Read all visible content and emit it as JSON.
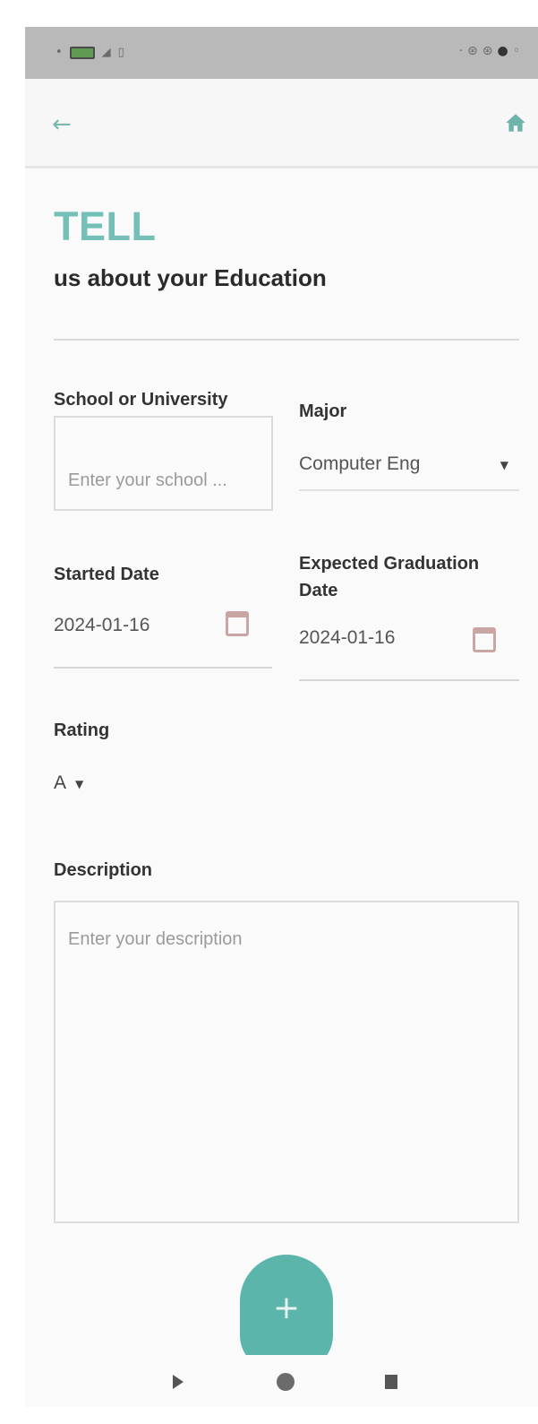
{
  "header": {
    "back_icon": "arrow-left-icon",
    "home_icon": "home-icon",
    "accent_color": "#74c0b6"
  },
  "intro": {
    "heading": "TELL",
    "subheading": "us about your Education"
  },
  "school": {
    "label": "School or University",
    "placeholder": "Enter your school ..."
  },
  "major": {
    "label": "Major",
    "value": "Computer Eng"
  },
  "started_date": {
    "label": "Started Date",
    "value": "2024-01-16"
  },
  "graduation_date": {
    "label": "Expected Graduation Date",
    "value": "2024-01-16"
  },
  "rating": {
    "label": "Rating",
    "value": "A"
  },
  "description": {
    "label": "Description",
    "placeholder": "Enter your description"
  },
  "fab": {
    "label": "+",
    "color": "#5bb5aa"
  }
}
